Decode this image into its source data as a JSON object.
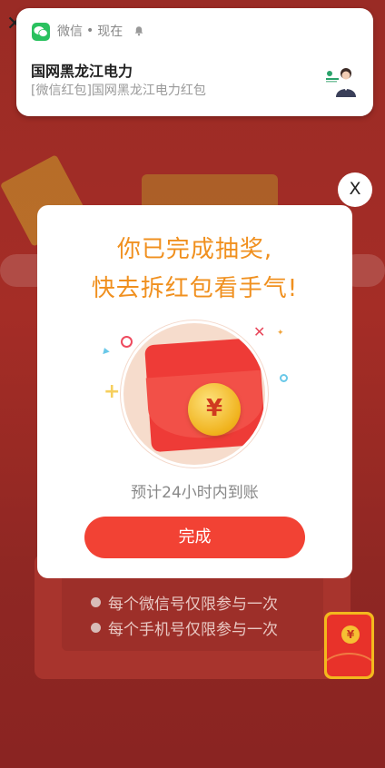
{
  "notification": {
    "app_name": "微信",
    "separator": "•",
    "time": "现在",
    "title": "国网黑龙江电力",
    "body": "[微信红包]国网黑龙江电力红包"
  },
  "background": {
    "rules": [
      "每个微信号仅限参与一次",
      "每个手机号仅限参与一次"
    ],
    "float_coin_symbol": "¥"
  },
  "modal": {
    "close_label": "X",
    "title_line1": "你已完成抽奖,",
    "title_line2": "快去拆红包看手气!",
    "coin_symbol": "¥",
    "subtitle": "预计24小时内到账",
    "done_button": "完成"
  },
  "colors": {
    "accent_orange": "#f0901f",
    "button_red": "#f24234",
    "wechat_green": "#2ac15f"
  },
  "icons": [
    "wechat-icon",
    "bell-icon",
    "close-icon",
    "back-arrow-icon",
    "red-envelope-icon",
    "coin-icon"
  ]
}
